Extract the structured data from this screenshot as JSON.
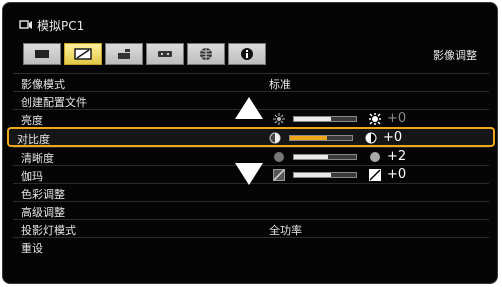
{
  "header": {
    "source_label": "模拟PC1",
    "menu_title": "影像调整"
  },
  "tabs": [
    {
      "name": "screen-tab"
    },
    {
      "name": "image-adjust-tab",
      "active": true
    },
    {
      "name": "projector-settings-tab"
    },
    {
      "name": "network-tab"
    },
    {
      "name": "globe-tab"
    },
    {
      "name": "info-tab"
    }
  ],
  "rows": {
    "image_mode": {
      "label": "影像模式",
      "value": "标准"
    },
    "create_profile": {
      "label": "创建配置文件"
    },
    "brightness": {
      "label": "亮度",
      "value": "+0",
      "level": 0.6
    },
    "contrast": {
      "label": "对比度",
      "value": "+0",
      "level": 0.6
    },
    "sharpness": {
      "label": "清晰度",
      "value": "+2",
      "level": 0.55
    },
    "gamma": {
      "label": "伽玛",
      "value": "+0",
      "level": 0.6
    },
    "color_adjust": {
      "label": "色彩调整"
    },
    "advanced_adjust": {
      "label": "高级调整"
    },
    "lamp_mode": {
      "label": "投影灯模式",
      "value": "全功率"
    },
    "reset": {
      "label": "重设"
    }
  },
  "colors": {
    "accent": "#f0a81b",
    "background": "#050505",
    "text": "#e6e6e6"
  }
}
